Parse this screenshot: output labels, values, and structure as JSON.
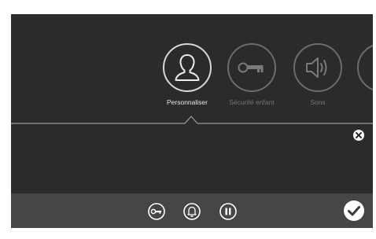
{
  "menu": {
    "items": [
      {
        "label": "Personnaliser",
        "icon": "person-icon",
        "active": true
      },
      {
        "label": "Sécurité enfant",
        "icon": "key-icon",
        "active": false
      },
      {
        "label": "Sons",
        "icon": "speaker-icon",
        "active": false
      }
    ]
  },
  "bottom_bar": {
    "icons": [
      "key-icon",
      "bell-icon",
      "pause-icon",
      "check-icon"
    ]
  },
  "colors": {
    "background": "#2b2b2b",
    "bottom_bar": "#464646",
    "active": "#e8e8e8",
    "inactive": "#767676"
  }
}
